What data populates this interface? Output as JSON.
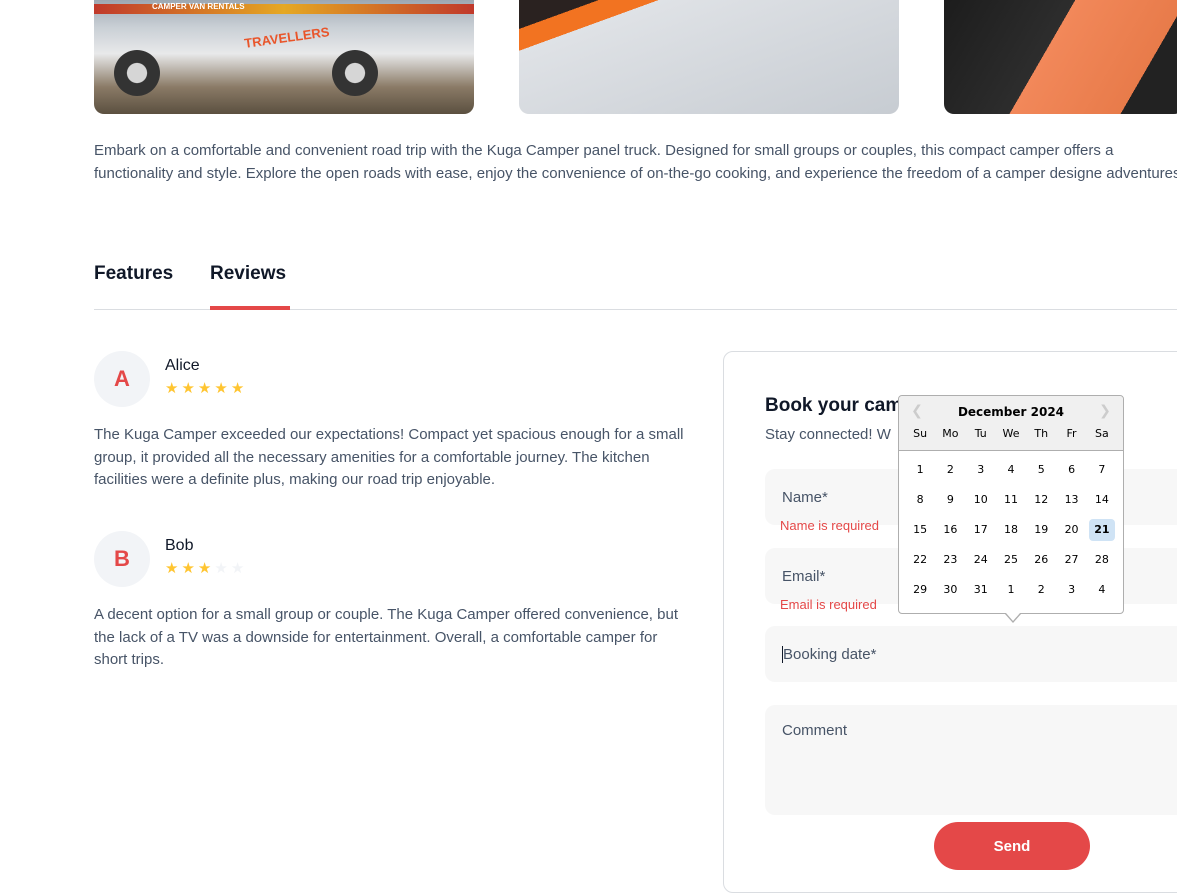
{
  "gallery": {
    "van_banner_text": "CAMPER VAN RENTALS",
    "van_logo_text": "TRAVELLERS"
  },
  "description": "Embark on a comfortable and convenient road trip with the Kuga Camper panel truck. Designed for small groups or couples, this compact camper offers a functionality and style. Explore the open roads with ease, enjoy the convenience of on-the-go cooking, and experience the freedom of a camper designe adventures.",
  "tabs": {
    "features": "Features",
    "reviews": "Reviews"
  },
  "reviews": [
    {
      "initial": "A",
      "name": "Alice",
      "rating": 5,
      "text": "The Kuga Camper exceeded our expectations! Compact yet spacious enough for a small group, it provided all the necessary amenities for a comfortable journey. The kitchen facilities were a definite plus, making our road trip enjoyable."
    },
    {
      "initial": "B",
      "name": "Bob",
      "rating": 3,
      "text": "A decent option for a small group or couple. The Kuga Camper offered convenience, but the lack of a TV was a downside for entertainment. Overall, a comfortable camper for short trips."
    }
  ],
  "form": {
    "title": "Book your cam",
    "subtitle": "Stay connected! W",
    "name_placeholder": "Name*",
    "name_error": "Name is required",
    "email_placeholder": "Email*",
    "email_error": "Email is required",
    "date_placeholder": "Booking date*",
    "comment_placeholder": "Comment",
    "send_label": "Send"
  },
  "datepicker": {
    "month_label": "December 2024",
    "prev_icon": "chevron-left-icon",
    "next_icon": "chevron-right-icon",
    "weekdays": [
      "Su",
      "Mo",
      "Tu",
      "We",
      "Th",
      "Fr",
      "Sa"
    ],
    "days": [
      "1",
      "2",
      "3",
      "4",
      "5",
      "6",
      "7",
      "8",
      "9",
      "10",
      "11",
      "12",
      "13",
      "14",
      "15",
      "16",
      "17",
      "18",
      "19",
      "20",
      "21",
      "22",
      "23",
      "24",
      "25",
      "26",
      "27",
      "28",
      "29",
      "30",
      "31",
      "1",
      "2",
      "3",
      "4"
    ],
    "selected_day": "21"
  },
  "colors": {
    "accent": "#e44848",
    "star": "#ffc531",
    "selected_day": "#cfe3f5"
  }
}
